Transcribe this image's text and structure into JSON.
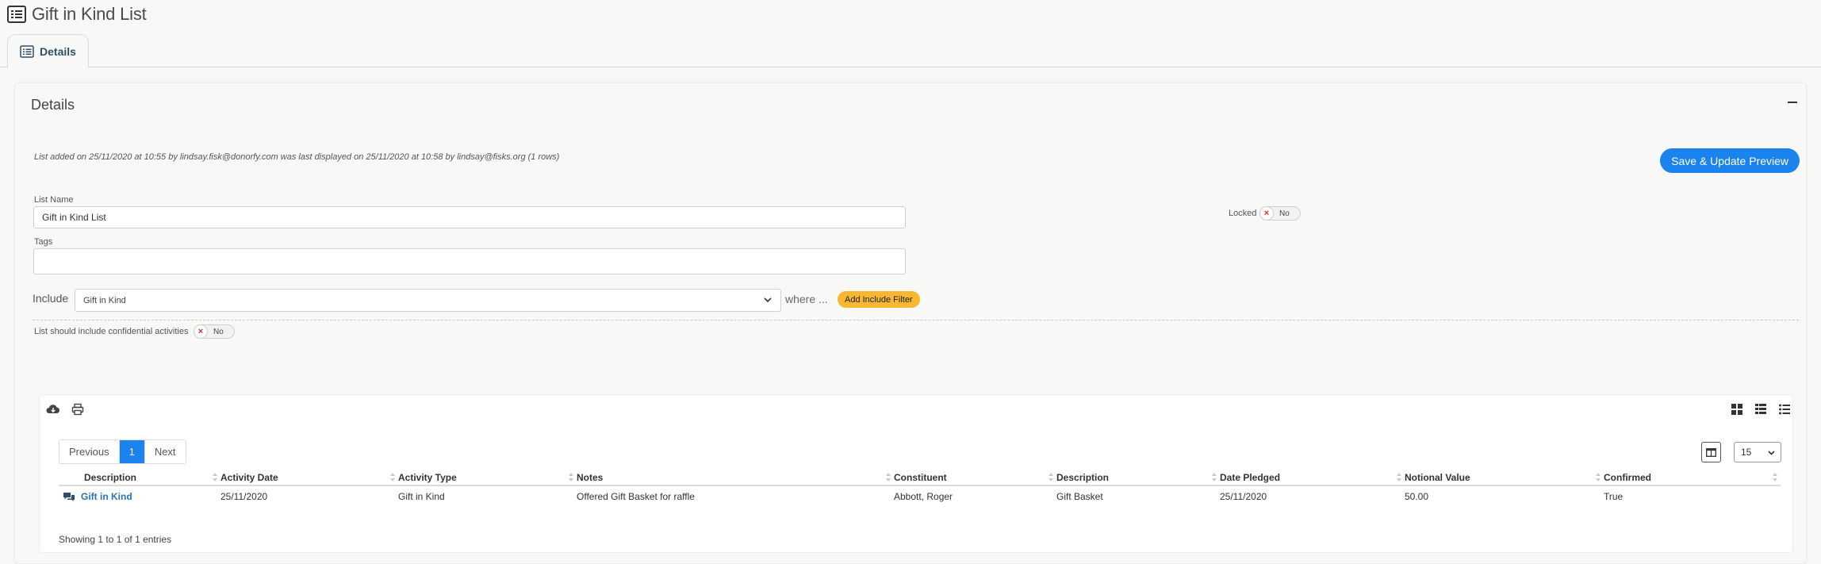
{
  "page": {
    "title": "Gift in Kind List"
  },
  "tabs": [
    {
      "label": "Details"
    }
  ],
  "details": {
    "panel_title": "Details",
    "meta": "List added on 25/11/2020 at 10:55 by lindsay.fisk@donorfy.com was last displayed on 25/11/2020 at 10:58 by lindsay@fisks.org (1 rows)",
    "save_label": "Save & Update Preview",
    "list_name_label": "List Name",
    "list_name_value": "Gift in Kind List",
    "tags_label": "Tags",
    "tags_value": "",
    "locked_label": "Locked",
    "locked_state": "No",
    "include_label": "Include",
    "include_value": "Gift in Kind",
    "where_label": "where ...",
    "add_filter_label": "Add Include Filter",
    "confidential_label": "List should include confidential activities",
    "confidential_state": "No"
  },
  "table": {
    "pager": {
      "previous": "Previous",
      "current": "1",
      "next": "Next"
    },
    "page_size": "15",
    "columns": [
      "Description",
      "Activity Date",
      "Activity Type",
      "Notes",
      "Constituent",
      "Description",
      "Date Pledged",
      "Notional Value",
      "Confirmed"
    ],
    "rows": [
      [
        "Gift in Kind",
        "25/11/2020",
        "Gift in Kind",
        "Offered Gift Basket for raffle",
        "Abbott, Roger",
        "Gift Basket",
        "25/11/2020",
        "50.00",
        "True"
      ]
    ],
    "info": "Showing 1 to 1 of 1 entries"
  }
}
